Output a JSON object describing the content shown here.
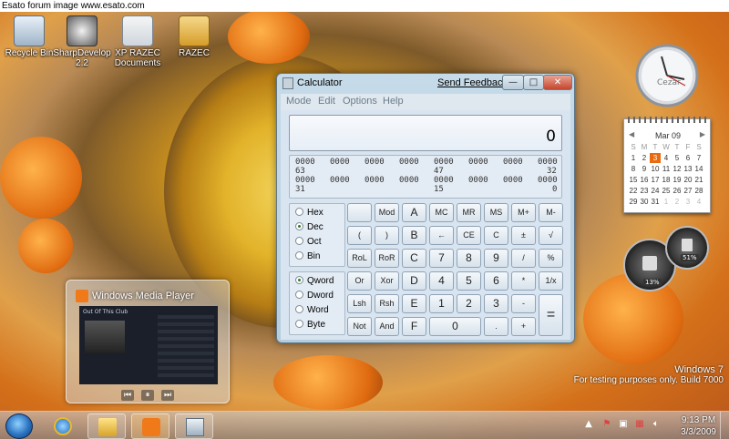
{
  "banner": "Esato forum image www.esato.com",
  "desktop_icons": [
    {
      "label": "Recycle Bin",
      "icon": "recycle-bin-icon"
    },
    {
      "label": "SharpDevelop 2.2",
      "icon": "sharpdevelop-icon"
    },
    {
      "label": "XP RAZEC Documents",
      "icon": "shortcut-folder-icon"
    },
    {
      "label": "RAZEC",
      "icon": "user-folder-icon"
    }
  ],
  "calculator": {
    "title": "Calculator",
    "feedback": "Send Feedback",
    "window_buttons": {
      "minimize": "—",
      "maximize": "□",
      "close": "✕"
    },
    "menu": [
      "Mode",
      "Edit",
      "Options",
      "Help"
    ],
    "display": "0",
    "bits_row1": [
      "0000",
      "0000",
      "0000",
      "0000",
      "0000",
      "0000",
      "0000",
      "0000"
    ],
    "bits_row1_labels": [
      "63",
      "47",
      "32"
    ],
    "bits_row2": [
      "0000",
      "0000",
      "0000",
      "0000",
      "0000",
      "0000",
      "0000",
      "0000"
    ],
    "bits_row2_labels": [
      "31",
      "15",
      "0"
    ],
    "base_options": [
      "Hex",
      "Dec",
      "Oct",
      "Bin"
    ],
    "base_selected": "Dec",
    "word_options": [
      "Qword",
      "Dword",
      "Word",
      "Byte"
    ],
    "word_selected": "Qword",
    "keys": {
      "r1": [
        "",
        "Mod",
        "A",
        "MC",
        "MR",
        "MS",
        "M+",
        "M-"
      ],
      "r2": [
        "(",
        ")",
        "B",
        "←",
        "CE",
        "C",
        "±",
        "√"
      ],
      "r3": [
        "RoL",
        "RoR",
        "C",
        "7",
        "8",
        "9",
        "/",
        "%"
      ],
      "r4": [
        "Or",
        "Xor",
        "D",
        "4",
        "5",
        "6",
        "*",
        "1/x"
      ],
      "r5": [
        "Lsh",
        "Rsh",
        "E",
        "1",
        "2",
        "3",
        "-",
        "="
      ],
      "r6": [
        "Not",
        "And",
        "F",
        "0",
        ".",
        "+"
      ]
    }
  },
  "media_player": {
    "title": "Windows Media Player",
    "now_playing": "Out Of This Club",
    "controls": [
      "⏮",
      "⏸",
      "⏭"
    ]
  },
  "clock_gadget": {
    "label": "Cezar"
  },
  "calendar_gadget": {
    "month": "Mar 09",
    "day_headers": [
      "S",
      "M",
      "T",
      "W",
      "T",
      "F",
      "S"
    ],
    "weeks": [
      [
        "1",
        "2",
        "3",
        "4",
        "5",
        "6",
        "7"
      ],
      [
        "8",
        "9",
        "10",
        "11",
        "12",
        "13",
        "14"
      ],
      [
        "15",
        "16",
        "17",
        "18",
        "19",
        "20",
        "21"
      ],
      [
        "22",
        "23",
        "24",
        "25",
        "26",
        "27",
        "28"
      ],
      [
        "29",
        "30",
        "31",
        "1",
        "2",
        "3",
        "4"
      ]
    ],
    "today": "3"
  },
  "cpu_meter": {
    "cpu": "13%",
    "memory": "51%"
  },
  "watermark": {
    "line1": "Windows 7",
    "line2": "For testing purposes only. Build 7000"
  },
  "taskbar": {
    "time": "9:13 PM",
    "date": "3/3/2009",
    "pinned": [
      "internet-explorer-icon",
      "windows-explorer-icon",
      "media-player-icon",
      "calculator-icon"
    ]
  },
  "colors": {
    "accent": "#e86b12",
    "taskbar": "#8aa2b8",
    "window_frame": "#b5cddd"
  }
}
